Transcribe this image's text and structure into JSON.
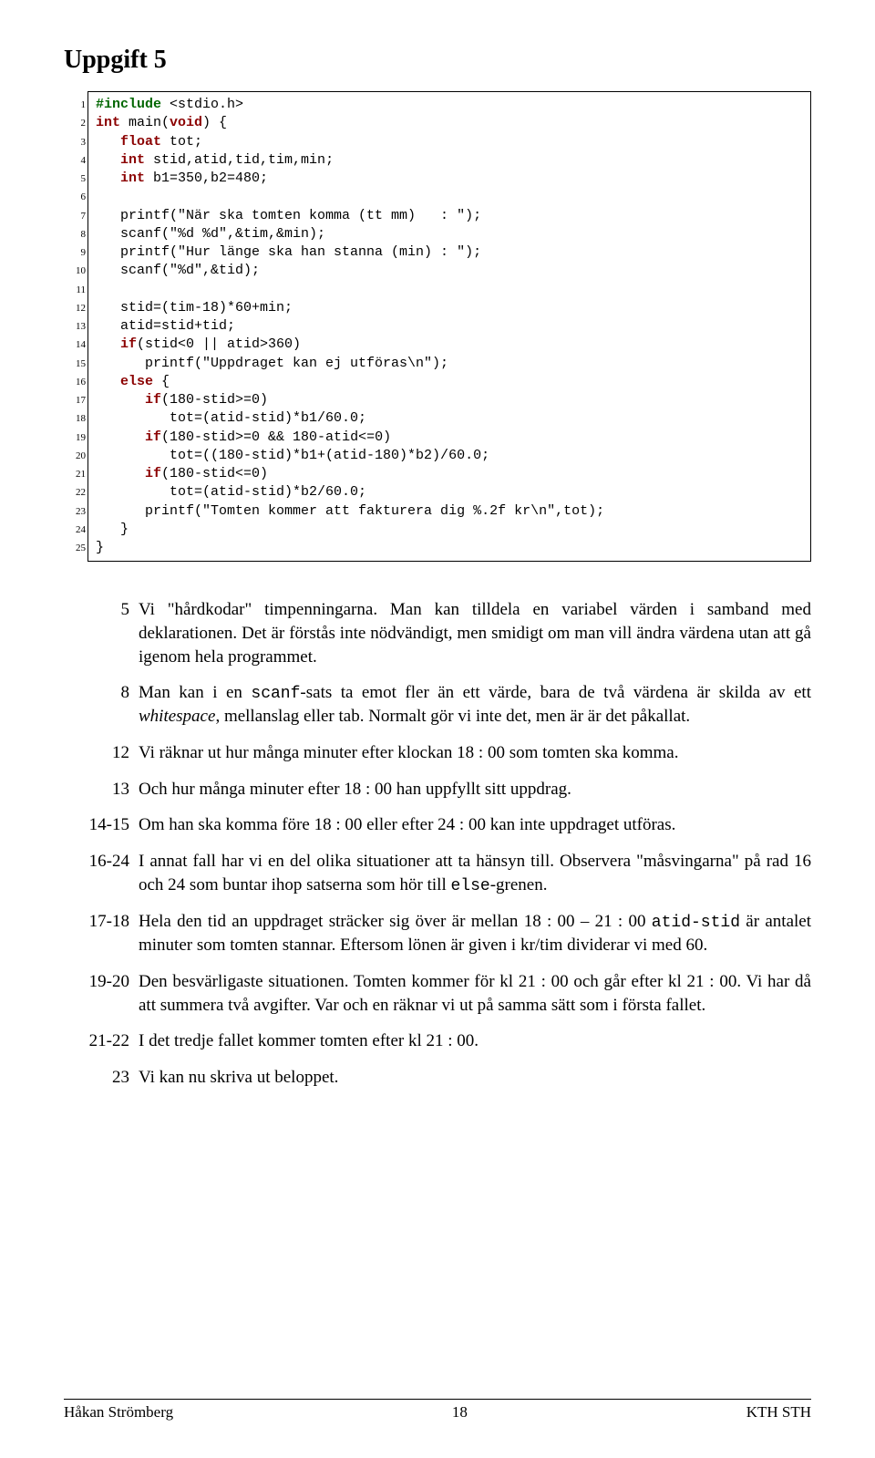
{
  "title": "Uppgift 5",
  "code": {
    "lines": [
      [
        {
          "t": "#include",
          "cls": "kw-preproc"
        },
        {
          "t": " <stdio.h>"
        }
      ],
      [
        {
          "t": "int",
          "cls": "kw-type"
        },
        {
          "t": " main("
        },
        {
          "t": "void",
          "cls": "kw-type"
        },
        {
          "t": ") {"
        }
      ],
      [
        {
          "t": "   "
        },
        {
          "t": "float",
          "cls": "kw-type"
        },
        {
          "t": " tot;"
        }
      ],
      [
        {
          "t": "   "
        },
        {
          "t": "int",
          "cls": "kw-type"
        },
        {
          "t": " stid,atid,tid,tim,min;"
        }
      ],
      [
        {
          "t": "   "
        },
        {
          "t": "int",
          "cls": "kw-type"
        },
        {
          "t": " b1=350,b2=480;"
        }
      ],
      [
        {
          "t": ""
        }
      ],
      [
        {
          "t": "   printf(\"När ska tomten komma (tt mm)   : \");"
        }
      ],
      [
        {
          "t": "   scanf(\"%d %d\",&tim,&min);"
        }
      ],
      [
        {
          "t": "   printf(\"Hur länge ska han stanna (min) : \");"
        }
      ],
      [
        {
          "t": "   scanf(\"%d\",&tid);"
        }
      ],
      [
        {
          "t": ""
        }
      ],
      [
        {
          "t": "   stid=(tim-18)*60+min;"
        }
      ],
      [
        {
          "t": "   atid=stid+tid;"
        }
      ],
      [
        {
          "t": "   "
        },
        {
          "t": "if",
          "cls": "kw-ctrl"
        },
        {
          "t": "(stid<0 || atid>360)"
        }
      ],
      [
        {
          "t": "      printf(\"Uppdraget kan ej utföras\\n\");"
        }
      ],
      [
        {
          "t": "   "
        },
        {
          "t": "else",
          "cls": "kw-ctrl"
        },
        {
          "t": " {"
        }
      ],
      [
        {
          "t": "      "
        },
        {
          "t": "if",
          "cls": "kw-ctrl"
        },
        {
          "t": "(180-stid>=0)"
        }
      ],
      [
        {
          "t": "         tot=(atid-stid)*b1/60.0;"
        }
      ],
      [
        {
          "t": "      "
        },
        {
          "t": "if",
          "cls": "kw-ctrl"
        },
        {
          "t": "(180-stid>=0 && 180-atid<=0)"
        }
      ],
      [
        {
          "t": "         tot=((180-stid)*b1+(atid-180)*b2)/60.0;"
        }
      ],
      [
        {
          "t": "      "
        },
        {
          "t": "if",
          "cls": "kw-ctrl"
        },
        {
          "t": "(180-stid<=0)"
        }
      ],
      [
        {
          "t": "         tot=(atid-stid)*b2/60.0;"
        }
      ],
      [
        {
          "t": "      printf(\"Tomten kommer att fakturera dig %.2f kr\\n\",tot);"
        }
      ],
      [
        {
          "t": "   }"
        }
      ],
      [
        {
          "t": "}"
        }
      ]
    ]
  },
  "explanations": [
    {
      "num": "5",
      "html": "Vi \"hårdkodar\" timpenningarna. Man kan tilldela en variabel värden i samband med deklarationen. Det är förstås inte nödvändigt, men smidigt om man vill ändra värdena utan att gå igenom hela programmet."
    },
    {
      "num": "8",
      "html": "Man kan i en <span class=\"mono\">scanf</span>-sats ta emot fler än ett värde, bara de två värdena är skilda av ett <em>whitespace</em>, mellanslag eller tab. Normalt gör vi inte det, men är är det påkallat."
    },
    {
      "num": "12",
      "html": "Vi räknar ut hur många minuter efter klockan 18 : 00 som tomten ska komma."
    },
    {
      "num": "13",
      "html": "Och hur många minuter efter 18 : 00 han uppfyllt sitt uppdrag."
    },
    {
      "num": "14-15",
      "html": "Om han ska komma före 18 : 00 eller efter 24 : 00 kan inte uppdraget utföras."
    },
    {
      "num": "16-24",
      "html": "I annat fall har vi en del olika situationer att ta hänsyn till. Observera \"måsvingarna\" på rad 16 och 24 som buntar ihop satserna som hör till <span class=\"mono\">else</span>-grenen."
    },
    {
      "num": "17-18",
      "html": "Hela den tid an uppdraget sträcker sig över är mellan 18 : 00 &ndash; 21 : 00 <span class=\"mono\">atid-stid</span> är antalet minuter som tomten stannar. Eftersom lönen är given i kr/tim dividerar vi med 60."
    },
    {
      "num": "19-20",
      "html": "Den besvärligaste situationen. Tomten kommer för kl 21 : 00 och går efter kl 21 : 00. Vi har då att summera två avgifter. Var och en räknar vi ut på samma sätt som i första fallet."
    },
    {
      "num": "21-22",
      "html": "I det tredje fallet kommer tomten efter kl 21 : 00."
    },
    {
      "num": "23",
      "html": "Vi kan nu skriva ut beloppet."
    }
  ],
  "footer": {
    "left": "Håkan Strömberg",
    "center": "18",
    "right": "KTH STH"
  }
}
